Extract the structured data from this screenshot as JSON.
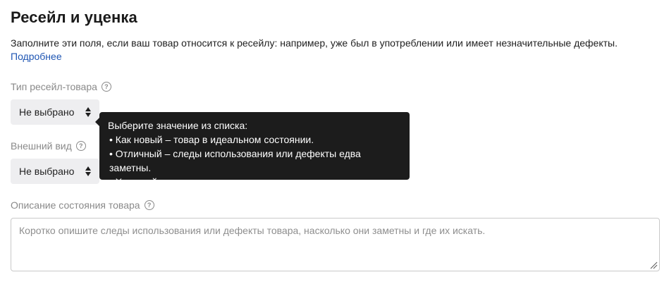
{
  "section": {
    "title": "Ресейл и уценка",
    "description": "Заполните эти поля, если ваш товар относится к ресейлу: например, уже был в употреблении или имеет незначительные дефекты.",
    "more_link": "Подробнее"
  },
  "fields": {
    "resale_type": {
      "label": "Тип ресейл-товара",
      "value": "Не выбрано"
    },
    "appearance": {
      "label": "Внешний вид",
      "value": "Не выбрано"
    },
    "condition": {
      "label": "Описание состояния товара",
      "placeholder": "Коротко опишите следы использования или дефекты товара, насколько они заметны и где их искать."
    }
  },
  "tooltip": {
    "heading": "Выберите значение из списка:",
    "items": [
      "• Как новый – товар в идеальном состоянии.",
      "• Отличный – следы использования или дефекты едва заметны.",
      "• Хороший – есть заметные следы использования или дефекты."
    ]
  },
  "icons": {
    "help": "question-circle-icon",
    "sort": "sort-arrows-icon",
    "resize": "resize-handle-icon"
  },
  "colors": {
    "link": "#1e55b3",
    "tooltip_bg": "#1c1c1c",
    "select_bg": "#eeeef0",
    "label": "#8a8a8a"
  }
}
